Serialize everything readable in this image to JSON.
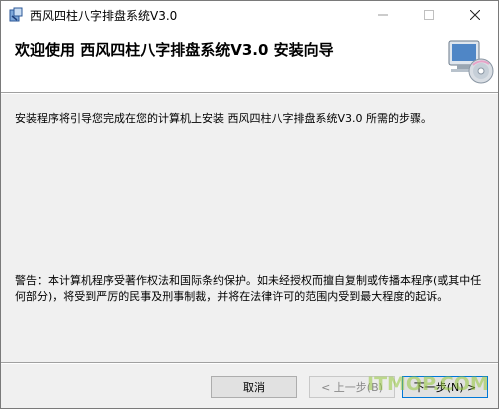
{
  "window": {
    "title": "西风四柱八字排盘系统V3.0"
  },
  "header": {
    "title": "欢迎使用 西风四柱八字排盘系统V3.0 安装向导",
    "graphic_icon": "computer-disc-icon"
  },
  "body": {
    "intro": "安装程序将引导您完成在您的计算机上安装 西风四柱八字排盘系统V3.0 所需的步骤。",
    "warning": "警告：本计算机程序受著作权法和国际条约保护。如未经授权而擅自复制或传播本程序(或其中任何部分)，将受到严厉的民事及刑事制裁，并将在法律许可的范围内受到最大程度的起诉。"
  },
  "buttons": {
    "cancel": "取消",
    "prev": "< 上一步(B)",
    "next": "下一步(N) >"
  },
  "watermark": "ITMOP.COM",
  "colors": {
    "accent": "#0078d7",
    "watermark": "#96c83c"
  }
}
